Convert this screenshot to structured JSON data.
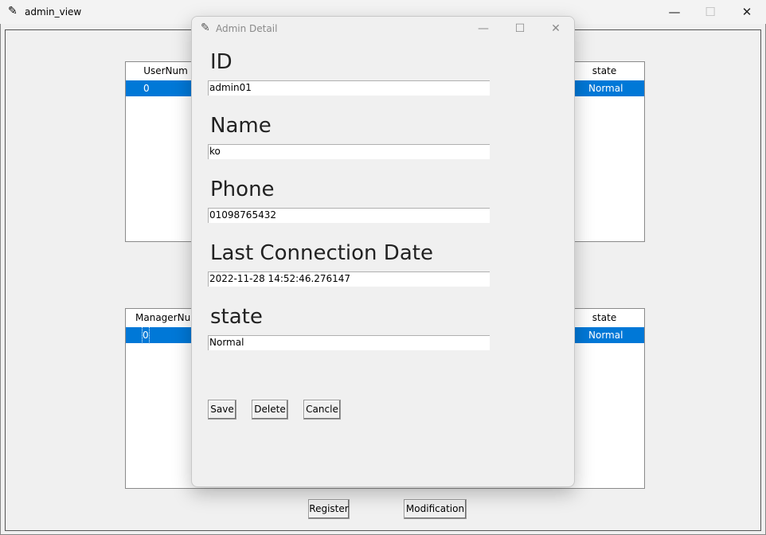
{
  "main_window": {
    "title": "admin_view",
    "icon": "feather-icon",
    "controls": {
      "minimize": "—",
      "maximize": "☐",
      "close": "✕"
    }
  },
  "user_table": {
    "columns": [
      "UserNum",
      "state"
    ],
    "selected_row": {
      "num": "0",
      "state": "Normal"
    }
  },
  "manager_table": {
    "columns": [
      "ManagerNum",
      "state"
    ],
    "selected_row": {
      "num": "0",
      "state": "Normal"
    }
  },
  "bottom_buttons": {
    "register": "Register",
    "modification": "Modification"
  },
  "dialog": {
    "title": "Admin Detail",
    "icon": "feather-icon",
    "controls": {
      "minimize": "—",
      "maximize": "☐",
      "close": "✕"
    },
    "fields": {
      "id": {
        "label": "ID",
        "value": "admin01"
      },
      "name": {
        "label": "Name",
        "value": "ko"
      },
      "phone": {
        "label": "Phone",
        "value": "01098765432"
      },
      "last_connection": {
        "label": "Last Connection Date",
        "value": "2022-11-28 14:52:46.276147"
      },
      "state": {
        "label": "state",
        "value": "Normal"
      }
    },
    "buttons": {
      "save": "Save",
      "delete": "Delete",
      "cancel": "Cancle"
    }
  },
  "colors": {
    "selection": "#0078d7",
    "window_bg": "#f0f0f0"
  }
}
